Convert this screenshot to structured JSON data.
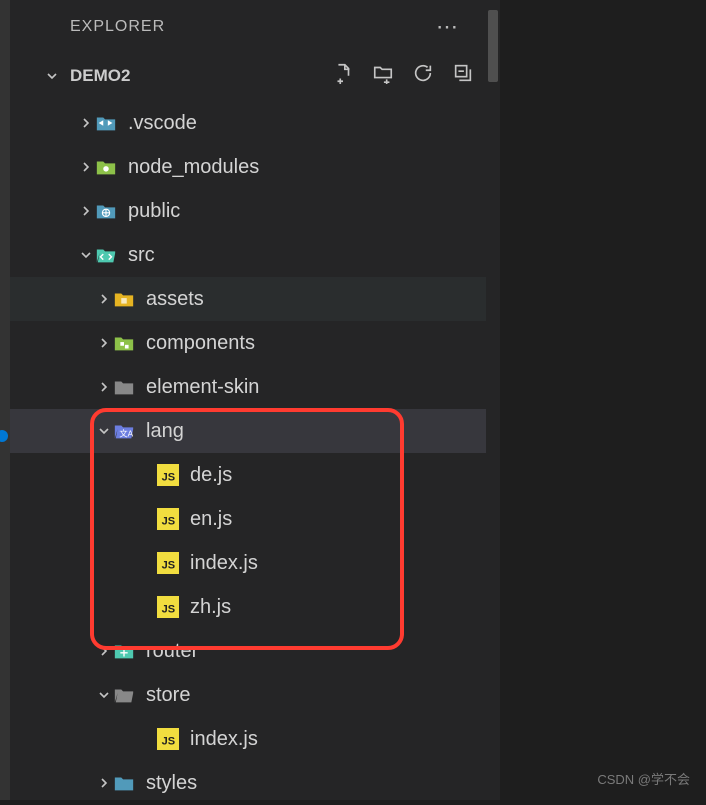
{
  "panel": {
    "title": "EXPLORER"
  },
  "section": {
    "title": "DEMO2"
  },
  "tree": [
    {
      "name": ".vscode",
      "type": "folder",
      "iconColor": "#519aba",
      "glyph": "vs",
      "indent": 1,
      "expanded": false
    },
    {
      "name": "node_modules",
      "type": "folder",
      "iconColor": "#8dc149",
      "glyph": "nm",
      "indent": 1,
      "expanded": false
    },
    {
      "name": "public",
      "type": "folder",
      "iconColor": "#519aba",
      "glyph": "globe",
      "indent": 1,
      "expanded": false
    },
    {
      "name": "src",
      "type": "folder",
      "iconColor": "#4ec9b0",
      "glyph": "code",
      "indent": 1,
      "expanded": true
    },
    {
      "name": "assets",
      "type": "folder",
      "iconColor": "#e6b422",
      "glyph": "asset",
      "indent": 2,
      "expanded": false,
      "hover": true
    },
    {
      "name": "components",
      "type": "folder",
      "iconColor": "#8dc149",
      "glyph": "comp",
      "indent": 2,
      "expanded": false
    },
    {
      "name": "element-skin",
      "type": "folder",
      "iconColor": "#888888",
      "glyph": "plain",
      "indent": 2,
      "expanded": false
    },
    {
      "name": "lang",
      "type": "folder",
      "iconColor": "#6c7ee1",
      "glyph": "lang",
      "indent": 2,
      "expanded": true,
      "selected": true
    },
    {
      "name": "de.js",
      "type": "file",
      "iconColor": "#f1dd3f",
      "glyph": "js",
      "indent": 3
    },
    {
      "name": "en.js",
      "type": "file",
      "iconColor": "#f1dd3f",
      "glyph": "js",
      "indent": 3
    },
    {
      "name": "index.js",
      "type": "file",
      "iconColor": "#f1dd3f",
      "glyph": "js",
      "indent": 3
    },
    {
      "name": "zh.js",
      "type": "file",
      "iconColor": "#f1dd3f",
      "glyph": "js",
      "indent": 3
    },
    {
      "name": "router",
      "type": "folder",
      "iconColor": "#4ec9b0",
      "glyph": "router",
      "indent": 2,
      "expanded": false
    },
    {
      "name": "store",
      "type": "folder",
      "iconColor": "#888888",
      "glyph": "plain",
      "indent": 2,
      "expanded": true
    },
    {
      "name": "index.js",
      "type": "file",
      "iconColor": "#f1dd3f",
      "glyph": "js",
      "indent": 3
    },
    {
      "name": "styles",
      "type": "folder",
      "iconColor": "#519aba",
      "glyph": "plain",
      "indent": 2,
      "expanded": false
    }
  ],
  "watermark": "CSDN @学不会"
}
